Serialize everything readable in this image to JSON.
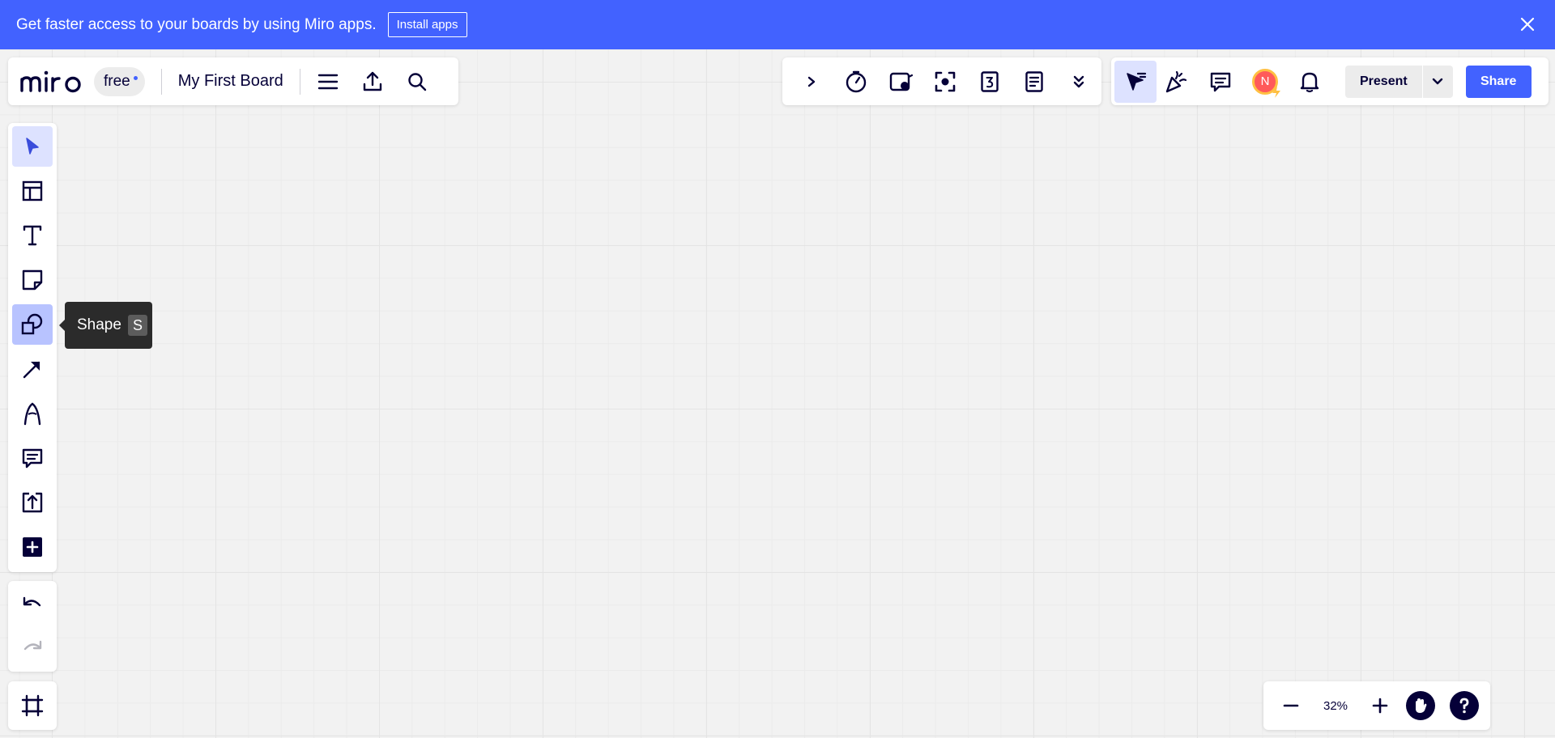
{
  "banner": {
    "text": "Get faster access to your boards by using Miro apps.",
    "install_label": "Install apps"
  },
  "board": {
    "plan": "free",
    "title": "My First Board"
  },
  "collab": {
    "avatar_initial": "N",
    "present_label": "Present",
    "share_label": "Share"
  },
  "tooltip": {
    "label": "Shape",
    "shortcut": "S"
  },
  "zoom": {
    "value": "32%"
  },
  "colors": {
    "accent": "#4262ff",
    "ink": "#050038",
    "avatar_bg": "#ff5a5a",
    "avatar_ring": "#ffc042"
  }
}
